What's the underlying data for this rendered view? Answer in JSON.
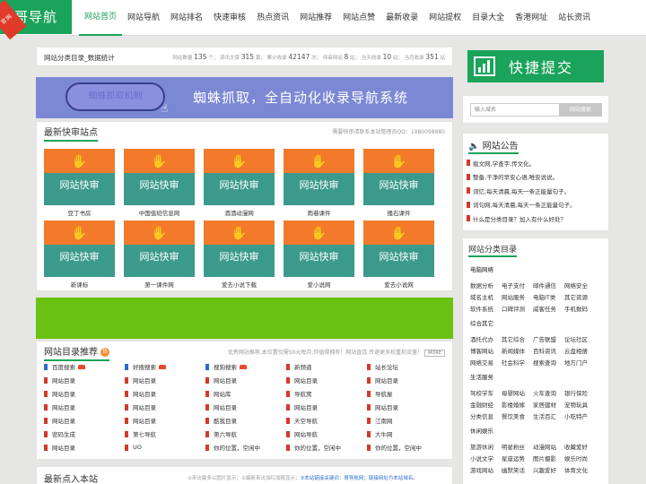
{
  "logo": {
    "text": "哥导航",
    "tag": "官网"
  },
  "nav": [
    "网站首页",
    "网站导航",
    "网站排名",
    "快速审核",
    "热点资讯",
    "网站推荐",
    "网站点赞",
    "最新收录",
    "网站提权",
    "目录大全",
    "香港网址",
    "站长资讯"
  ],
  "stats": {
    "title": "网站分类目录_数据统计",
    "items": [
      {
        "label": "网站数量",
        "value": "135",
        "unit": "个"
      },
      {
        "label": "资讯文章",
        "value": "315",
        "unit": "篇"
      },
      {
        "label": "累计收录",
        "value": "42147",
        "unit": "次"
      },
      {
        "label": "待审网站",
        "value": "8",
        "unit": "站"
      },
      {
        "label": "当天收录",
        "value": "10",
        "unit": "站"
      },
      {
        "label": "当月收录",
        "value": "351",
        "unit": "站"
      }
    ]
  },
  "banner": {
    "pill": "蜘蛛抓取机制",
    "text": "蜘蛛抓取，全自动化收录导航系统"
  },
  "fast_review": {
    "title": "最新快审站点",
    "note": "需要快审请联系本站管理员QQ：1980098880",
    "thumb_label": "网站快审",
    "sites": [
      "豆丁书房",
      "中国值班信息网",
      "酒酒动漫网",
      "雨巷课件",
      "搔石课件",
      "新课标",
      "第一课件网",
      "爱去小说下载",
      "爱小说网",
      "爱去小说网"
    ]
  },
  "directory": {
    "title": "网站目录推荐",
    "badge": "热",
    "note": "优秀网站推荐,本位置仅需50元每月,你值得拥有！网站直连,传递更多权重和流量！",
    "more": "MORE",
    "items": [
      [
        "百度搜索",
        "好搜搜索",
        "搜狗搜索",
        "新频道",
        "站长论坛"
      ],
      [
        "网站目录",
        "网站目录",
        "网站目录",
        "网站目录",
        "网站目录"
      ],
      [
        "网站目录",
        "网站目录",
        "网站库",
        "导航窝",
        "导航屋"
      ],
      [
        "网站目录",
        "网站目录",
        "网站目录",
        "网站目录",
        "网站目录"
      ],
      [
        "网站目录",
        "网站目录",
        "酷我目录",
        "天空导航",
        "江南网"
      ],
      [
        "密码生成",
        "第七导航",
        "第六导航",
        "网站导航",
        "大牛网"
      ],
      [
        "网站目录",
        "UO",
        "你的位置，空闲中",
        "你的位置，空闲中",
        "你的位置，空闲中"
      ]
    ]
  },
  "latest": {
    "title": "最新点入本站",
    "note_gray": "①来访最多以图片显示；②最新来访加红加粗显示；",
    "note_blue": "③本站链接关键词：哥导航网；链接网址为本站域名。"
  },
  "quick_submit": {
    "text": "快捷提交"
  },
  "url_form": {
    "placeholder": "输入域名",
    "button": "网站搜索"
  },
  "announcements": {
    "title": "网站公告",
    "items": [
      "痴文网,学查字,传文化。",
      "整备,干净的早安心语,唯安说说。",
      "词忆,每天清晨,每天一条正能量句子。",
      "词句网,每天清晨,每天一条正能量句子。",
      "什么是分类目录？加入有什么好处？"
    ]
  },
  "categories": {
    "title": "网站分类目录",
    "groups": [
      {
        "name": "电脑网络",
        "rows": [
          [
            "数据分析",
            "电子支付",
            "邮件通信",
            "网络安全"
          ],
          [
            "域名主机",
            "网站服务",
            "电脑IT类",
            "其它资源"
          ],
          [
            "软件系统",
            "口碑评测",
            "威客任务",
            "手机数码"
          ]
        ]
      },
      {
        "name": "综合其它",
        "rows": [
          [
            "酒托代办",
            "其它综合",
            "广告联盟",
            "论坛社区"
          ],
          [
            "博客网站",
            "新闻媒体",
            "百科资讯",
            "云盘相册"
          ],
          [
            "网络交易",
            "社会科学",
            "搜索查询",
            "地方门户"
          ]
        ]
      },
      {
        "name": "生活服务",
        "rows": [
          [
            "驾校学车",
            "母婴网站",
            "火车查询",
            "银行保险"
          ],
          [
            "金融财经",
            "影楼婚嫁",
            "家居建材",
            "宠物玩具"
          ],
          [
            "分类信息",
            "餐饮美食",
            "生活百汇",
            "小吃特产"
          ]
        ]
      },
      {
        "name": "休闲娱乐",
        "rows": [
          [
            "旅游休闲",
            "明星粉丝",
            "动漫网站",
            "收藏爱好"
          ],
          [
            "小说文学",
            "星座运势",
            "图片摄影",
            "娱乐时尚"
          ],
          [
            "游戏网站",
            "幽默笑话",
            "兴趣爱好",
            "体育文化"
          ]
        ]
      }
    ]
  },
  "colors": {
    "brand": "#1aa35a",
    "orange": "#f27a2a",
    "teal": "#3c9a8c",
    "banner": "#7d88d4",
    "green_bar": "#6ac112"
  }
}
